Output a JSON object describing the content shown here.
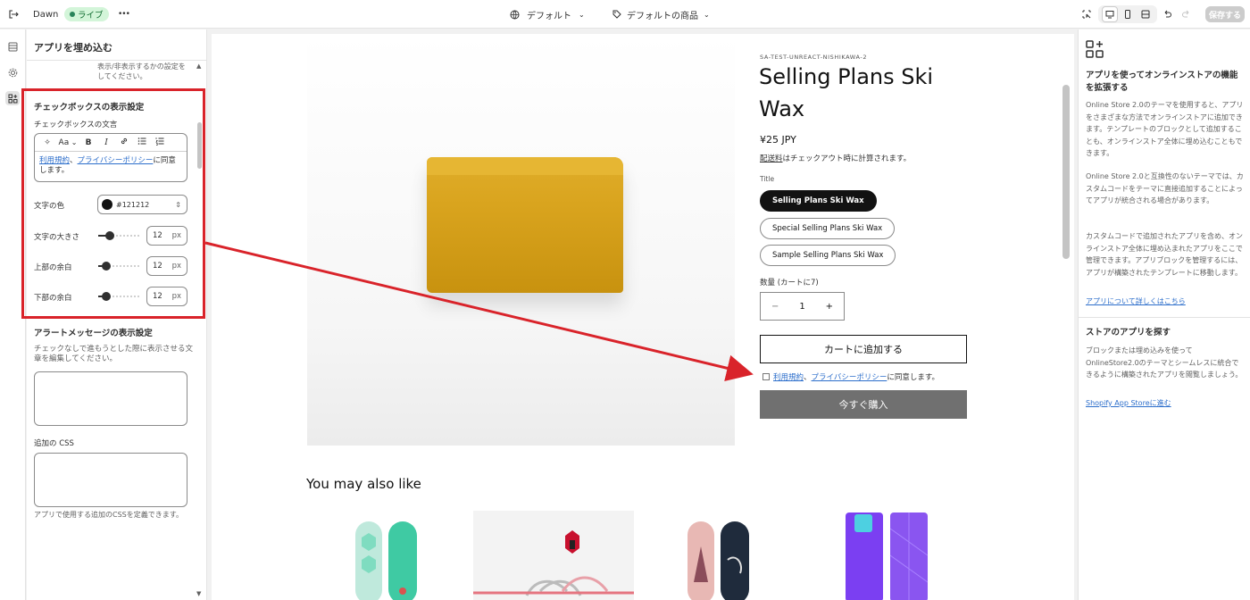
{
  "topbar": {
    "theme_name": "Dawn",
    "live_badge": "ライブ",
    "more": "•••",
    "template_selector": "デフォルト",
    "product_selector": "デフォルトの商品",
    "save_label": "保存する"
  },
  "left_panel": {
    "title": "アプリを埋め込む",
    "scrolled_hint": "表示/非表示するかの設定をしてください。",
    "checkbox_section": {
      "heading": "チェックボックスの表示設定",
      "text_label": "チェックボックスの文言",
      "rte_tools": [
        "✧",
        "Aa",
        "B",
        "I",
        "🔗",
        "☰",
        "☷"
      ],
      "rte_link1": "利用規約",
      "rte_sep": "、",
      "rte_link2": "プライバシーポリシー",
      "rte_tail": "に同意します。",
      "text_color_label": "文字の色",
      "text_color_value": "#121212",
      "font_size_label": "文字の大きさ",
      "font_size_value": "12",
      "margin_top_label": "上部の余白",
      "margin_top_value": "12",
      "margin_bottom_label": "下部の余白",
      "margin_bottom_value": "12",
      "unit": "px"
    },
    "alert_section": {
      "heading": "アラートメッセージの表示設定",
      "desc": "チェックなしで進もうとした際に表示させる文章を編集してください。",
      "css_label": "追加の CSS",
      "css_help": "アプリで使用する追加のCSSを定義できます。"
    }
  },
  "product": {
    "vendor": "SA-TEST-UNREACT-NISHIKAWA-2",
    "title": "Selling Plans Ski Wax",
    "price": "¥25 JPY",
    "shipping_link": "配送料",
    "shipping_tail": "はチェックアウト時に計算されます。",
    "option_label": "Title",
    "variants": [
      "Selling Plans Ski Wax",
      "Special Selling Plans Ski Wax",
      "Sample Selling Plans Ski Wax"
    ],
    "qty_label": "数量 (カートに7)",
    "qty_minus": "−",
    "qty_value": "1",
    "qty_plus": "+",
    "add_to_cart": "カートに追加する",
    "agree_link1": "利用規約",
    "agree_sep": "、",
    "agree_link2": "プライバシーポリシー",
    "agree_tail": "に同意します。",
    "buy_now": "今すぐ購入",
    "also_like": "You may also like"
  },
  "right_panel": {
    "heading1": "アプリを使ってオンラインストアの機能を拡張する",
    "p1": "Online Store 2.0のテーマを使用すると、アプリをさまざまな方法でオンラインストアに追加できます。テンプレートのブロックとして追加することも、オンラインストア全体に埋め込むこともできます。",
    "p2": "Online Store 2.0と互換性のないテーマでは、カスタムコードをテーマに直接追加することによってアプリが統合される場合があります。",
    "p3": "カスタムコードで追加されたアプリを含め、オンラインストア全体に埋め込まれたアプリをここで管理できます。アプリブロックを管理するには、アプリが構築されたテンプレートに移動します。",
    "link1": "アプリについて詳しくはこちら",
    "heading2": "ストアのアプリを探す",
    "p4": "ブロックまたは埋め込みを使ってOnlineStore2.0のテーマとシームレスに統合できるように構築されたアプリを閲覧しましょう。",
    "link2": "Shopify App Storeに進む"
  },
  "colors": {
    "highlight": "#d9232a",
    "accent_link": "#2c6ecb",
    "wax": "#d9a41e"
  }
}
